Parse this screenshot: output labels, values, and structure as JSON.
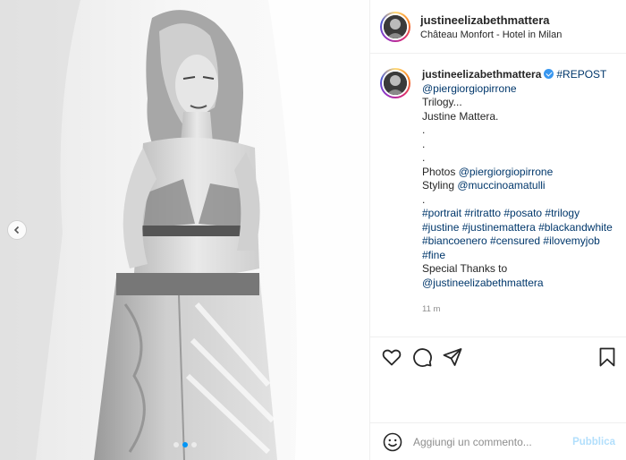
{
  "post": {
    "username": "justineelizabethmattera",
    "header_username": "justineelizabethmattera",
    "location": "Château Monfort - Hotel in Milan"
  },
  "caption": {
    "username": "justineelizabethmattera",
    "lines": [
      {
        "text": "#REPOST",
        "link": true,
        "after_user": true
      },
      {
        "text": "@piergiorgiopirrone",
        "link": true
      },
      {
        "text": "Trilogy...",
        "link": false
      },
      {
        "text": "Justine Mattera.",
        "link": false
      },
      {
        "text": ".",
        "link": false
      },
      {
        "text": ".",
        "link": false
      },
      {
        "text": ".",
        "link": false
      },
      {
        "prefix": "Photos ",
        "text": "@piergiorgiopirrone",
        "link": true
      },
      {
        "prefix": "Styling ",
        "text": "@muccinoamatulli",
        "link": true
      },
      {
        "text": ".",
        "link": false
      },
      {
        "text": "#portrait #ritratto #posato #trilogy",
        "link": true
      },
      {
        "text": "#justine #justinemattera #blackandwhite",
        "link": true
      },
      {
        "text": "#biancoenero #censured #ilovemyjob",
        "link": true
      },
      {
        "text": "#fine",
        "link": true
      },
      {
        "text": "Special Thanks to",
        "link": false
      },
      {
        "text": "@justineelizabethmattera",
        "link": true
      }
    ],
    "time": "11 m"
  },
  "actions": {
    "icons": [
      "heart-icon",
      "comment-icon",
      "share-icon",
      "bookmark-icon"
    ]
  },
  "comment": {
    "placeholder": "Aggiungi un commento...",
    "publish_label": "Pubblica"
  },
  "colors": {
    "link": "#00376b",
    "verified": "#3897f0",
    "publish_disabled": "#b2dffc",
    "muted": "#8e8e8e"
  }
}
